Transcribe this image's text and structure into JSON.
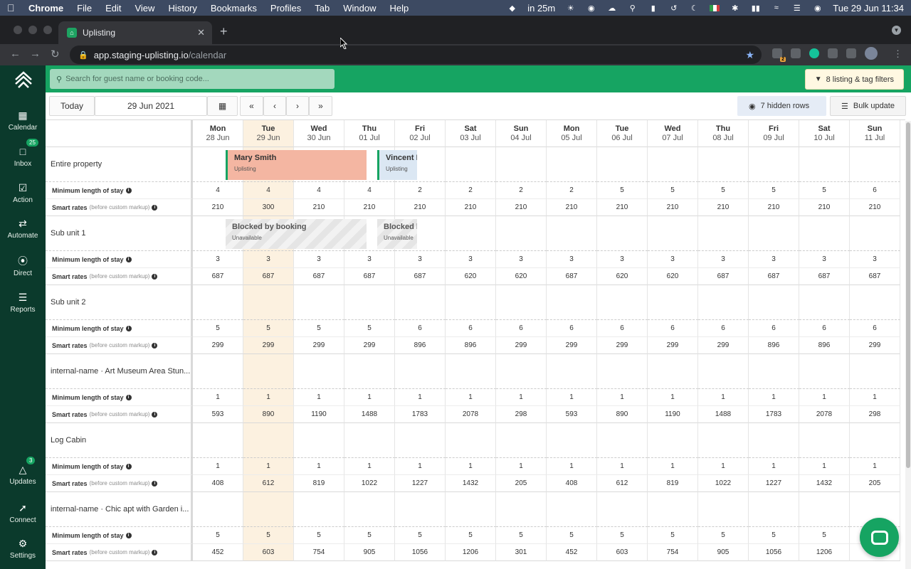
{
  "menubar": {
    "items": [
      "Chrome",
      "File",
      "Edit",
      "View",
      "History",
      "Bookmarks",
      "Profiles",
      "Tab",
      "Window",
      "Help"
    ],
    "status_reminder": "in 25m",
    "clock": "Tue 29 Jun  11:34"
  },
  "browser": {
    "tab_title": "Uplisting",
    "url_host": "app.staging-uplisting.io",
    "url_path": "/calendar",
    "extension_badge": "2"
  },
  "sidebar": {
    "items": [
      {
        "label": "Calendar",
        "icon": "calendar-icon"
      },
      {
        "label": "Inbox",
        "icon": "chat-icon",
        "badge": "25"
      },
      {
        "label": "Action",
        "icon": "check-square-icon"
      },
      {
        "label": "Automate",
        "icon": "shuffle-icon"
      },
      {
        "label": "Direct",
        "icon": "direct-icon"
      },
      {
        "label": "Reports",
        "icon": "database-icon"
      },
      {
        "label": "Updates",
        "icon": "bell-icon",
        "badge": "3"
      },
      {
        "label": "Connect",
        "icon": "plug-icon"
      },
      {
        "label": "Settings",
        "icon": "gear-icon"
      }
    ]
  },
  "header": {
    "search_placeholder": "Search for guest name or booking code...",
    "filters_label": "8 listing & tag filters"
  },
  "controls": {
    "today_label": "Today",
    "date_value": "29 Jun 2021",
    "nav": [
      "«",
      "‹",
      "›",
      "»"
    ],
    "hidden_rows_label": "7 hidden rows",
    "bulk_update_label": "Bulk update"
  },
  "calendar": {
    "days": [
      {
        "dow": "Mon",
        "date": "28 Jun"
      },
      {
        "dow": "Tue",
        "date": "29 Jun"
      },
      {
        "dow": "Wed",
        "date": "30 Jun"
      },
      {
        "dow": "Thu",
        "date": "01 Jul"
      },
      {
        "dow": "Fri",
        "date": "02 Jul"
      },
      {
        "dow": "Sat",
        "date": "03 Jul"
      },
      {
        "dow": "Sun",
        "date": "04 Jul"
      },
      {
        "dow": "Mon",
        "date": "05 Jul"
      },
      {
        "dow": "Tue",
        "date": "06 Jul"
      },
      {
        "dow": "Wed",
        "date": "07 Jul"
      },
      {
        "dow": "Thu",
        "date": "08 Jul"
      },
      {
        "dow": "Fri",
        "date": "09 Jul"
      },
      {
        "dow": "Sat",
        "date": "10 Jul"
      },
      {
        "dow": "Sun",
        "date": "11 Jul"
      }
    ],
    "mls_label": "Minimum length of stay",
    "rates_label": "Smart rates",
    "rates_note": "(before custom markup)",
    "properties": [
      {
        "name": "Entire property",
        "mls": [
          "4",
          "4",
          "4",
          "4",
          "2",
          "2",
          "2",
          "2",
          "5",
          "5",
          "5",
          "5",
          "5",
          "6"
        ],
        "rates": [
          "210",
          "300",
          "210",
          "210",
          "210",
          "210",
          "210",
          "210",
          "210",
          "210",
          "210",
          "210",
          "210",
          "210"
        ]
      },
      {
        "name": "Sub unit 1",
        "mls": [
          "3",
          "3",
          "3",
          "3",
          "3",
          "3",
          "3",
          "3",
          "3",
          "3",
          "3",
          "3",
          "3",
          "3"
        ],
        "rates": [
          "687",
          "687",
          "687",
          "687",
          "687",
          "620",
          "620",
          "687",
          "620",
          "620",
          "687",
          "687",
          "687",
          "687"
        ]
      },
      {
        "name": "Sub unit 2",
        "mls": [
          "5",
          "5",
          "5",
          "5",
          "6",
          "6",
          "6",
          "6",
          "6",
          "6",
          "6",
          "6",
          "6",
          "6"
        ],
        "rates": [
          "299",
          "299",
          "299",
          "299",
          "896",
          "896",
          "299",
          "299",
          "299",
          "299",
          "299",
          "896",
          "896",
          "299"
        ]
      },
      {
        "name": "internal-name · Art Museum Area Stun...",
        "mls": [
          "1",
          "1",
          "1",
          "1",
          "1",
          "1",
          "1",
          "1",
          "1",
          "1",
          "1",
          "1",
          "1",
          "1"
        ],
        "rates": [
          "593",
          "890",
          "1190",
          "1488",
          "1783",
          "2078",
          "298",
          "593",
          "890",
          "1190",
          "1488",
          "1783",
          "2078",
          "298"
        ]
      },
      {
        "name": "Log Cabin",
        "mls": [
          "1",
          "1",
          "1",
          "1",
          "1",
          "1",
          "1",
          "1",
          "1",
          "1",
          "1",
          "1",
          "1",
          "1"
        ],
        "rates": [
          "408",
          "612",
          "819",
          "1022",
          "1227",
          "1432",
          "205",
          "408",
          "612",
          "819",
          "1022",
          "1227",
          "1432",
          "205"
        ]
      },
      {
        "name": "internal-name · Chic apt with Garden i...",
        "mls": [
          "5",
          "5",
          "5",
          "5",
          "5",
          "5",
          "5",
          "5",
          "5",
          "5",
          "5",
          "5",
          "5",
          ""
        ],
        "rates": [
          "452",
          "603",
          "754",
          "905",
          "1056",
          "1206",
          "301",
          "452",
          "603",
          "754",
          "905",
          "1056",
          "1206",
          ""
        ]
      }
    ],
    "bookings": [
      {
        "name": "Mary Smith",
        "sub": "Uplisting"
      },
      {
        "name": "Vincent B",
        "sub": "Uplisting"
      },
      {
        "name": "Blocked by booking",
        "sub": "Unavailable"
      },
      {
        "name": "Blocked by",
        "sub": "Unavailable"
      }
    ]
  },
  "colors": {
    "brand_green": "#16a462",
    "sidebar_dark": "#0b3a2c",
    "booking_salmon": "#f4b6a2",
    "booking_blue": "#dbe7f3",
    "today_highlight": "#fcf1e0"
  }
}
